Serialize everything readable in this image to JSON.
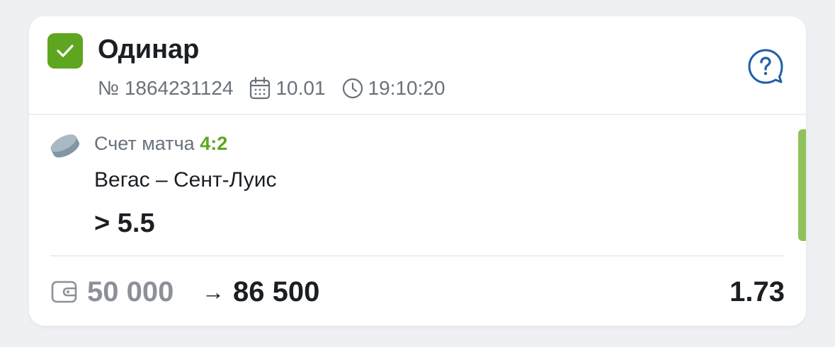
{
  "bet": {
    "type_label": "Одинар",
    "number": "№ 1864231124",
    "date": "10.01",
    "time": "19:10:20"
  },
  "selection": {
    "market_label": "Счет матча",
    "score": "4:2",
    "match": "Вегас – Сент-Луис",
    "outcome": "> 5.5"
  },
  "footer": {
    "stake": "50 000",
    "arrow": "→",
    "win": "86 500",
    "coefficient": "1.73"
  },
  "icons": {
    "check": "check-icon",
    "calendar": "calendar-icon",
    "clock": "clock-icon",
    "help": "help-bubble-icon",
    "sport": "hockey-puck-icon",
    "wallet": "wallet-icon"
  },
  "colors": {
    "accent_green": "#5fa620",
    "status_bar": "#8fc25a",
    "help_blue": "#1f5fa8",
    "muted_text": "#6a717b"
  }
}
